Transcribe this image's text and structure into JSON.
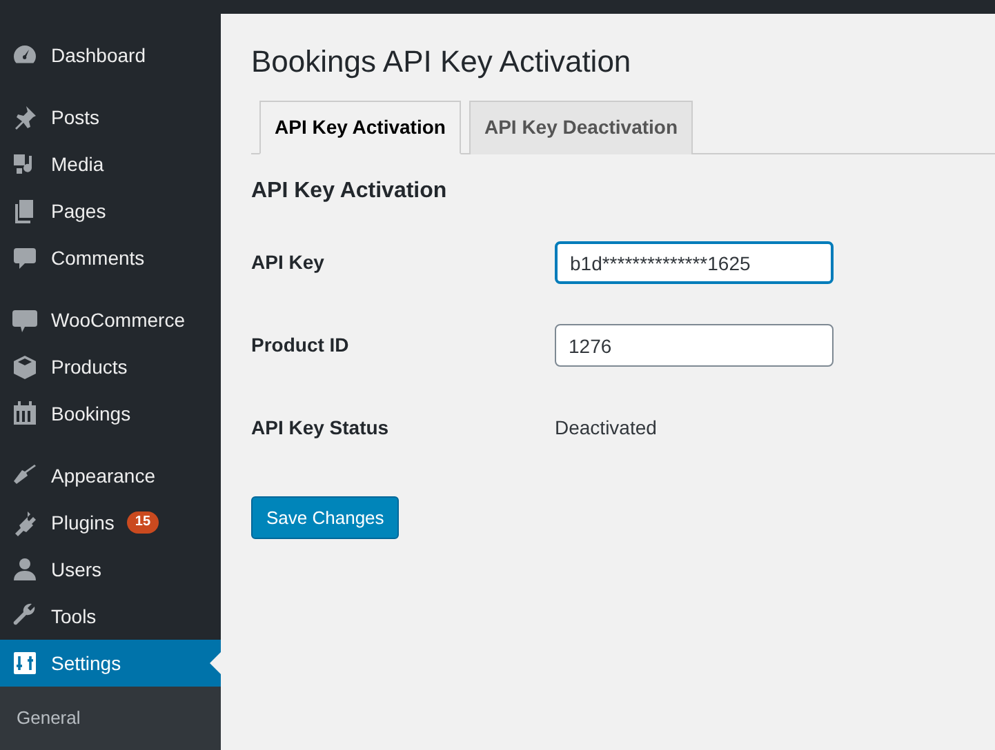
{
  "sidebar": {
    "groups": [
      [
        {
          "label": "Dashboard",
          "selected": false
        }
      ],
      [
        {
          "label": "Posts",
          "selected": false
        },
        {
          "label": "Media",
          "selected": false
        },
        {
          "label": "Pages",
          "selected": false
        },
        {
          "label": "Comments",
          "selected": false
        }
      ],
      [
        {
          "label": "WooCommerce",
          "selected": false
        },
        {
          "label": "Products",
          "selected": false
        },
        {
          "label": "Bookings",
          "selected": false
        }
      ],
      [
        {
          "label": "Appearance",
          "selected": false
        },
        {
          "label": "Plugins",
          "selected": false,
          "badge": "15"
        },
        {
          "label": "Users",
          "selected": false
        },
        {
          "label": "Tools",
          "selected": false
        },
        {
          "label": "Settings",
          "selected": true
        }
      ]
    ],
    "submenu": [
      {
        "label": "General",
        "selected": false
      }
    ]
  },
  "page": {
    "title": "Bookings API Key Activation",
    "tabs": [
      {
        "label": "API Key Activation",
        "selected": true
      },
      {
        "label": "API Key Deactivation",
        "selected": false
      }
    ],
    "section_title": "API Key Activation",
    "fields": [
      {
        "kind": "input",
        "label": "API Key",
        "value": "b1d**************1625",
        "focused": true
      },
      {
        "kind": "input",
        "label": "Product ID",
        "value": "1276",
        "focused": false
      },
      {
        "kind": "text",
        "label": "API Key Status",
        "value": "Deactivated"
      }
    ],
    "save_button": "Save Changes"
  }
}
